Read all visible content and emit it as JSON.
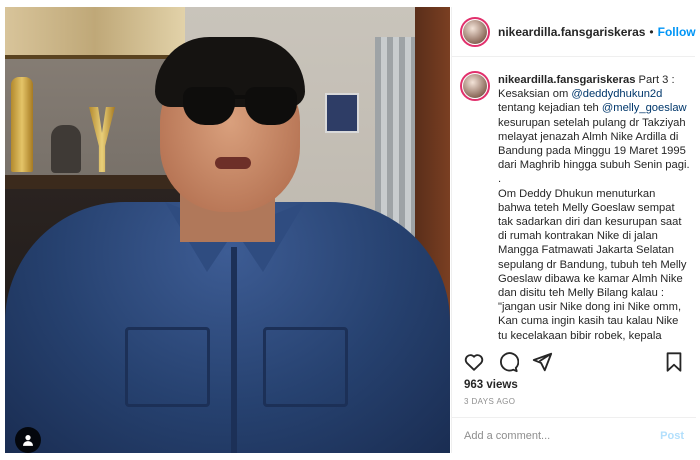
{
  "post": {
    "username": "nikeardilla.fansgariskeras",
    "follow_label": "Follow",
    "separator": "•",
    "caption": {
      "username": "nikeardilla.fansgariskeras",
      "line1": " Part 3 :",
      "line2a": "Kesaksian om ",
      "mention1": "@deddydhukun2d",
      "line3a": "tentang kejadian teh ",
      "mention2": "@melly_goeslaw",
      "body": "\nkesurupan setelah pulang dr Takziyah melayat jenazah Almh Nike Ardilla di Bandung pada Minggu 19 Maret 1995 dari Maghrib hingga subuh Senin pagi.\n.\nOm Deddy Dhukun menuturkan bahwa teteh Melly Goeslaw sempat tak sadarkan diri dan kesurupan saat di rumah kontrakan Nike di jalan Mangga Fatmawati Jakarta Selatan sepulang dr Bandung, tubuh teh Melly Goeslaw dibawa ke kamar Almh Nike dan disitu teh Melly Bilang kalau :\n\"jangan usir Nike dong ini Nike omm, Kan cuma ingin kasih tau kalau Nike tu kecelakaan bibir robek, kepala pecah dsbnya, Kasih tau dong sama si X"
    },
    "views": "963 views",
    "time_ago": "3 DAYS AGO",
    "comment_placeholder": "Add a comment...",
    "post_label": "Post"
  },
  "icons": {
    "like": "heart-icon",
    "comment": "comment-icon",
    "share": "share-icon",
    "save": "bookmark-icon",
    "user_tag": "user-tag-icon"
  },
  "colors": {
    "accent": "#0095f6",
    "post_disabled": "#b2dffc",
    "story_ring": "#e1306c"
  }
}
